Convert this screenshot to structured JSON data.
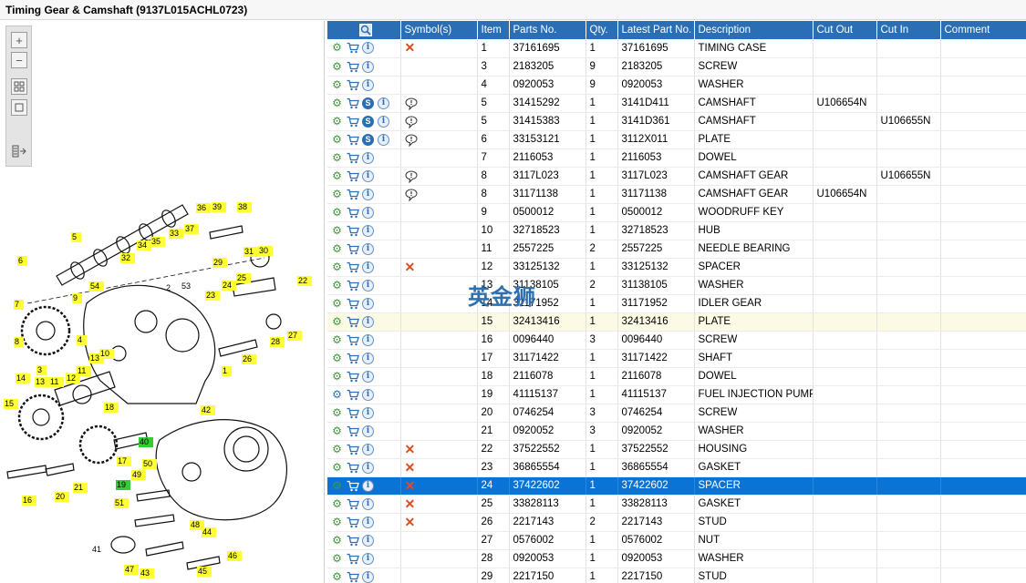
{
  "title": "Timing Gear & Camshaft (9137L015ACHL0723)",
  "watermark": "英金狮",
  "toolbar": [
    {
      "name": "zoom-in-button",
      "icon": "zoom-in-icon"
    },
    {
      "name": "zoom-out-button",
      "icon": "zoom-out-icon"
    },
    {
      "name": "fit-page-button",
      "icon": "fit-page-icon"
    },
    {
      "name": "actual-size-button",
      "icon": "actual-size-icon"
    },
    {
      "name": "export-button",
      "icon": "export-icon"
    }
  ],
  "columns": [
    "",
    "Symbol(s)",
    "Item",
    "Parts No.",
    "Qty.",
    "Latest Part No.",
    "Description",
    "Cut Out",
    "Cut In",
    "Comment"
  ],
  "rows": [
    {
      "action": "cog",
      "icons": [
        "cart",
        "info"
      ],
      "symbol": "x",
      "item": "1",
      "part": "37161695",
      "qty": "1",
      "latest": "37161695",
      "desc": "TIMING CASE",
      "cutout": "",
      "cutin": "",
      "comment": ""
    },
    {
      "action": "cog",
      "icons": [
        "cart",
        "info"
      ],
      "symbol": "",
      "item": "3",
      "part": "2183205",
      "qty": "9",
      "latest": "2183205",
      "desc": "SCREW",
      "cutout": "",
      "cutin": "",
      "comment": ""
    },
    {
      "action": "cog",
      "icons": [
        "cart",
        "info"
      ],
      "symbol": "",
      "item": "4",
      "part": "0920053",
      "qty": "9",
      "latest": "0920053",
      "desc": "WASHER",
      "cutout": "",
      "cutin": "",
      "comment": ""
    },
    {
      "action": "cog",
      "icons": [
        "cart",
        "s",
        "info"
      ],
      "symbol": "bubble",
      "item": "5",
      "part": "31415292",
      "qty": "1",
      "latest": "3141D411",
      "desc": "CAMSHAFT",
      "cutout": "U106654N",
      "cutin": "",
      "comment": ""
    },
    {
      "action": "cog",
      "icons": [
        "cart",
        "s",
        "info"
      ],
      "symbol": "bubble",
      "item": "5",
      "part": "31415383",
      "qty": "1",
      "latest": "3141D361",
      "desc": "CAMSHAFT",
      "cutout": "",
      "cutin": "U106655N",
      "comment": ""
    },
    {
      "action": "cog",
      "icons": [
        "cart",
        "s",
        "info"
      ],
      "symbol": "bubble",
      "item": "6",
      "part": "33153121",
      "qty": "1",
      "latest": "3112X011",
      "desc": "PLATE",
      "cutout": "",
      "cutin": "",
      "comment": ""
    },
    {
      "action": "cog",
      "icons": [
        "cart",
        "info"
      ],
      "symbol": "",
      "item": "7",
      "part": "2116053",
      "qty": "1",
      "latest": "2116053",
      "desc": "DOWEL",
      "cutout": "",
      "cutin": "",
      "comment": ""
    },
    {
      "action": "cog",
      "icons": [
        "cart",
        "info"
      ],
      "symbol": "bubble",
      "item": "8",
      "part": "3117L023",
      "qty": "1",
      "latest": "3117L023",
      "desc": "CAMSHAFT GEAR",
      "cutout": "",
      "cutin": "U106655N",
      "comment": ""
    },
    {
      "action": "cog",
      "icons": [
        "cart",
        "info"
      ],
      "symbol": "bubble",
      "item": "8",
      "part": "31171138",
      "qty": "1",
      "latest": "31171138",
      "desc": "CAMSHAFT GEAR",
      "cutout": "U106654N",
      "cutin": "",
      "comment": ""
    },
    {
      "action": "cog",
      "icons": [
        "cart",
        "info"
      ],
      "symbol": "",
      "item": "9",
      "part": "0500012",
      "qty": "1",
      "latest": "0500012",
      "desc": "WOODRUFF KEY",
      "cutout": "",
      "cutin": "",
      "comment": ""
    },
    {
      "action": "cog",
      "icons": [
        "cart",
        "info"
      ],
      "symbol": "",
      "item": "10",
      "part": "32718523",
      "qty": "1",
      "latest": "32718523",
      "desc": "HUB",
      "cutout": "",
      "cutin": "",
      "comment": ""
    },
    {
      "action": "cog",
      "icons": [
        "cart",
        "info"
      ],
      "symbol": "",
      "item": "11",
      "part": "2557225",
      "qty": "2",
      "latest": "2557225",
      "desc": "NEEDLE BEARING",
      "cutout": "",
      "cutin": "",
      "comment": ""
    },
    {
      "action": "cog",
      "icons": [
        "cart",
        "info"
      ],
      "symbol": "x",
      "item": "12",
      "part": "33125132",
      "qty": "1",
      "latest": "33125132",
      "desc": "SPACER",
      "cutout": "",
      "cutin": "",
      "comment": ""
    },
    {
      "action": "cog",
      "icons": [
        "cart",
        "info"
      ],
      "symbol": "",
      "item": "13",
      "part": "31138105",
      "qty": "2",
      "latest": "31138105",
      "desc": "WASHER",
      "cutout": "",
      "cutin": "",
      "comment": ""
    },
    {
      "action": "cog",
      "icons": [
        "cart",
        "info"
      ],
      "symbol": "",
      "item": "14",
      "part": "31171952",
      "qty": "1",
      "latest": "31171952",
      "desc": "IDLER GEAR",
      "cutout": "",
      "cutin": "",
      "comment": ""
    },
    {
      "action": "cog",
      "icons": [
        "cart",
        "info"
      ],
      "symbol": "",
      "item": "15",
      "part": "32413416",
      "qty": "1",
      "latest": "32413416",
      "desc": "PLATE",
      "cutout": "",
      "cutin": "",
      "comment": "",
      "hl": true
    },
    {
      "action": "cog",
      "icons": [
        "cart",
        "info"
      ],
      "symbol": "",
      "item": "16",
      "part": "0096440",
      "qty": "3",
      "latest": "0096440",
      "desc": "SCREW",
      "cutout": "",
      "cutin": "",
      "comment": ""
    },
    {
      "action": "cog",
      "icons": [
        "cart",
        "info"
      ],
      "symbol": "",
      "item": "17",
      "part": "31171422",
      "qty": "1",
      "latest": "31171422",
      "desc": "SHAFT",
      "cutout": "",
      "cutin": "",
      "comment": ""
    },
    {
      "action": "cog",
      "icons": [
        "cart",
        "info"
      ],
      "symbol": "",
      "item": "18",
      "part": "2116078",
      "qty": "1",
      "latest": "2116078",
      "desc": "DOWEL",
      "cutout": "",
      "cutin": "",
      "comment": ""
    },
    {
      "action": "cog2",
      "icons": [
        "cart",
        "info"
      ],
      "symbol": "",
      "item": "19",
      "part": "41115137",
      "qty": "1",
      "latest": "41115137",
      "desc": "FUEL INJECTION PUMP G",
      "cutout": "",
      "cutin": "",
      "comment": ""
    },
    {
      "action": "cog",
      "icons": [
        "cart",
        "info"
      ],
      "symbol": "",
      "item": "20",
      "part": "0746254",
      "qty": "3",
      "latest": "0746254",
      "desc": "SCREW",
      "cutout": "",
      "cutin": "",
      "comment": ""
    },
    {
      "action": "cog",
      "icons": [
        "cart",
        "info"
      ],
      "symbol": "",
      "item": "21",
      "part": "0920052",
      "qty": "3",
      "latest": "0920052",
      "desc": "WASHER",
      "cutout": "",
      "cutin": "",
      "comment": ""
    },
    {
      "action": "cog",
      "icons": [
        "cart",
        "info"
      ],
      "symbol": "x",
      "item": "22",
      "part": "37522552",
      "qty": "1",
      "latest": "37522552",
      "desc": "HOUSING",
      "cutout": "",
      "cutin": "",
      "comment": ""
    },
    {
      "action": "cog",
      "icons": [
        "cart",
        "info"
      ],
      "symbol": "x",
      "item": "23",
      "part": "36865554",
      "qty": "1",
      "latest": "36865554",
      "desc": "GASKET",
      "cutout": "",
      "cutin": "",
      "comment": ""
    },
    {
      "action": "cog",
      "icons": [
        "cart",
        "info"
      ],
      "symbol": "x",
      "item": "24",
      "part": "37422602",
      "qty": "1",
      "latest": "37422602",
      "desc": "SPACER",
      "cutout": "",
      "cutin": "",
      "comment": "",
      "selected": true
    },
    {
      "action": "cog",
      "icons": [
        "cart",
        "info"
      ],
      "symbol": "x",
      "item": "25",
      "part": "33828113",
      "qty": "1",
      "latest": "33828113",
      "desc": "GASKET",
      "cutout": "",
      "cutin": "",
      "comment": ""
    },
    {
      "action": "cog",
      "icons": [
        "cart",
        "info"
      ],
      "symbol": "x",
      "item": "26",
      "part": "2217143",
      "qty": "2",
      "latest": "2217143",
      "desc": "STUD",
      "cutout": "",
      "cutin": "",
      "comment": ""
    },
    {
      "action": "cog",
      "icons": [
        "cart",
        "info"
      ],
      "symbol": "",
      "item": "27",
      "part": "0576002",
      "qty": "1",
      "latest": "0576002",
      "desc": "NUT",
      "cutout": "",
      "cutin": "",
      "comment": ""
    },
    {
      "action": "cog",
      "icons": [
        "cart",
        "info"
      ],
      "symbol": "",
      "item": "28",
      "part": "0920053",
      "qty": "1",
      "latest": "0920053",
      "desc": "WASHER",
      "cutout": "",
      "cutin": "",
      "comment": ""
    },
    {
      "action": "cog",
      "icons": [
        "cart",
        "info"
      ],
      "symbol": "",
      "item": "29",
      "part": "2217150",
      "qty": "1",
      "latest": "2217150",
      "desc": "STUD",
      "cutout": "",
      "cutin": "",
      "comment": ""
    }
  ],
  "callouts": [
    {
      "n": "36",
      "color": "yellow"
    },
    {
      "n": "39",
      "color": "yellow"
    },
    {
      "n": "38",
      "color": "yellow"
    },
    {
      "n": "37",
      "color": "yellow"
    },
    {
      "n": "33",
      "color": "yellow"
    },
    {
      "n": "5",
      "color": "yellow"
    },
    {
      "n": "34",
      "color": "yellow"
    },
    {
      "n": "35",
      "color": "yellow"
    },
    {
      "n": "31",
      "color": "yellow"
    },
    {
      "n": "30",
      "color": "yellow"
    },
    {
      "n": "32",
      "color": "yellow"
    },
    {
      "n": "29",
      "color": "yellow"
    },
    {
      "n": "6",
      "color": "yellow"
    },
    {
      "n": "2",
      "color": "plain"
    },
    {
      "n": "53",
      "color": "plain"
    },
    {
      "n": "24",
      "color": "yellow"
    },
    {
      "n": "25",
      "color": "yellow"
    },
    {
      "n": "22",
      "color": "yellow"
    },
    {
      "n": "54",
      "color": "yellow"
    },
    {
      "n": "23",
      "color": "yellow"
    },
    {
      "n": "7",
      "color": "yellow"
    },
    {
      "n": "9",
      "color": "yellow"
    },
    {
      "n": "28",
      "color": "yellow"
    },
    {
      "n": "27",
      "color": "yellow"
    },
    {
      "n": "8",
      "color": "yellow"
    },
    {
      "n": "4",
      "color": "yellow"
    },
    {
      "n": "13",
      "color": "yellow"
    },
    {
      "n": "10",
      "color": "yellow"
    },
    {
      "n": "26",
      "color": "yellow"
    },
    {
      "n": "3",
      "color": "yellow"
    },
    {
      "n": "11",
      "color": "yellow"
    },
    {
      "n": "1",
      "color": "yellow"
    },
    {
      "n": "14",
      "color": "yellow"
    },
    {
      "n": "13",
      "color": "yellow"
    },
    {
      "n": "11",
      "color": "yellow"
    },
    {
      "n": "12",
      "color": "yellow"
    },
    {
      "n": "15",
      "color": "yellow"
    },
    {
      "n": "18",
      "color": "yellow"
    },
    {
      "n": "42",
      "color": "yellow"
    },
    {
      "n": "40",
      "color": "green"
    },
    {
      "n": "17",
      "color": "yellow"
    },
    {
      "n": "49",
      "color": "yellow"
    },
    {
      "n": "50",
      "color": "yellow"
    },
    {
      "n": "19",
      "color": "green"
    },
    {
      "n": "16",
      "color": "yellow"
    },
    {
      "n": "20",
      "color": "yellow"
    },
    {
      "n": "21",
      "color": "yellow"
    },
    {
      "n": "51",
      "color": "yellow"
    },
    {
      "n": "48",
      "color": "yellow"
    },
    {
      "n": "44",
      "color": "yellow"
    },
    {
      "n": "41",
      "color": "plain"
    },
    {
      "n": "46",
      "color": "yellow"
    },
    {
      "n": "47",
      "color": "yellow"
    },
    {
      "n": "43",
      "color": "yellow"
    },
    {
      "n": "45",
      "color": "yellow"
    }
  ],
  "colors": {
    "header": "#2a6fb5",
    "selected_row": "#0a74d6",
    "highlight_row": "#fbfbe5",
    "callout_yellow": "#ffff33",
    "callout_green": "#33cc33",
    "symbol_x": "#e24a1a"
  }
}
